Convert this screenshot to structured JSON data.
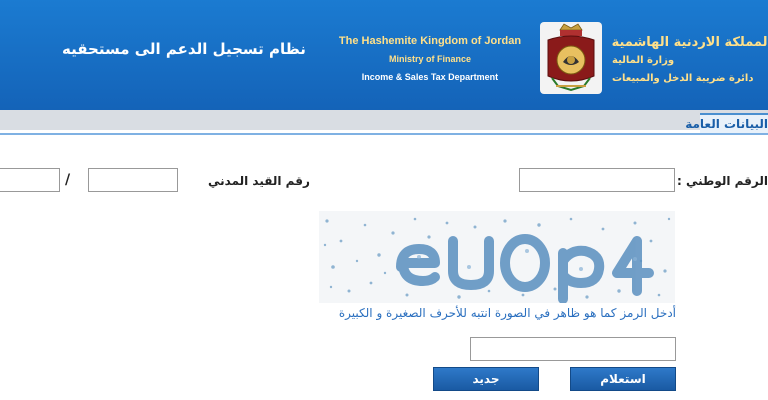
{
  "header": {
    "system_title": "نظام تسجيل الدعم الى مستحقيه",
    "en_kingdom": "The Hashemite Kingdom of Jordan",
    "en_ministry": "Ministry of Finance",
    "en_department": "Income & Sales Tax Department",
    "ar_kingdom": "المملكة الاردنية الهاشمية",
    "ar_ministry": "وزارة المالية",
    "ar_department": "دائرة ضريبة الدخل والمبيعات",
    "background_color": "#1769c2",
    "gold_text_color": "#ffe08a"
  },
  "tabs": {
    "general": "البيانات العامة"
  },
  "form": {
    "national_number_label": "الرقم الوطني :",
    "national_number_value": "",
    "civil_registry_label": "رقم القيد المدني",
    "civil_registry_value": "",
    "civil_registry_value_2": "",
    "separator": "/",
    "captcha_text": "eU0p4",
    "captcha_hint": "أدخل الرمز كما هو ظاهر في الصورة انتبه للأحرف الصغيرة و الكبيرة",
    "captcha_input_value": "",
    "submit_label": "استعلام",
    "new_label": "جديد"
  },
  "colors": {
    "button_blue": "#1f66b3",
    "link_blue": "#2a6fbf"
  }
}
